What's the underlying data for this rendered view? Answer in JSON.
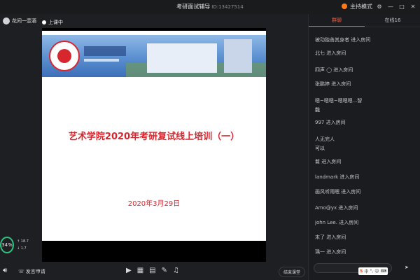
{
  "window": {
    "title": "考研面试辅导",
    "room_id": "ID:13427514",
    "mode_label": "主持模式",
    "controls": [
      "gear-icon",
      "minimize-icon",
      "maximize-icon",
      "close-icon"
    ]
  },
  "stage": {
    "host_name": "花间一壶酒",
    "status_label": "上课中",
    "slide": {
      "banner_logo_alt": "",
      "title": "艺术学院2020年考研复试线上培训（一）",
      "date": "2020年3月29日"
    },
    "network": {
      "percent": "34",
      "up_rate": "18.7",
      "down_rate": "1.7"
    }
  },
  "toolbar": {
    "mic_label": "发言申请",
    "tools": [
      "video-icon",
      "image-icon",
      "document-icon",
      "edit-icon",
      "music-icon"
    ],
    "end_label": "结束课堂"
  },
  "panel": {
    "tabs": [
      {
        "label": "群聊",
        "active": true
      },
      {
        "label": "在线16",
        "active": false
      }
    ],
    "messages": [
      {
        "name": "被动独善其身者",
        "text": "进入房间"
      },
      {
        "name": "北七",
        "text": "进入房间"
      },
      {
        "name": "四声 ◯",
        "text": "进入房间"
      },
      {
        "name": "张鹏婷",
        "text": "进入房间"
      },
      {
        "name": "嗯~嗯嗯~嗯嗯嗯...智",
        "text": "",
        "sub": "能"
      },
      {
        "name": "997",
        "text": "进入房间"
      },
      {
        "name": "人无完人",
        "text": "",
        "sub": "可以"
      },
      {
        "name": "鬘",
        "text": "进入房间"
      },
      {
        "name": "landmark",
        "text": "进入房间"
      },
      {
        "name": "画风听雨眠",
        "text": "进入房间"
      },
      {
        "name": "Amo@yx",
        "text": "进入房间"
      },
      {
        "name": "john Lee.",
        "text": "进入房间"
      },
      {
        "name": "末了",
        "text": "进入房间"
      },
      {
        "name": "瑀一",
        "text": "进入房间"
      }
    ],
    "input_placeholder": "",
    "ime_labels": [
      "S",
      "中",
      "°,",
      "☺",
      "⌨"
    ],
    "send_label": "➤"
  }
}
